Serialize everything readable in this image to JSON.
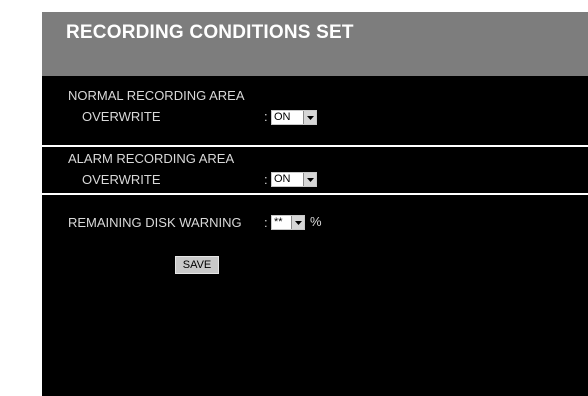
{
  "header": {
    "title": "RECORDING CONDITIONS SET"
  },
  "normal_area": {
    "heading": "NORMAL RECORDING AREA",
    "overwrite_label": "OVERWRITE",
    "separator": ":",
    "overwrite_value": "ON"
  },
  "alarm_area": {
    "heading": "ALARM RECORDING AREA",
    "overwrite_label": "OVERWRITE",
    "separator": ":",
    "overwrite_value": "ON"
  },
  "disk_warning": {
    "label": "REMAINING DISK WARNING",
    "separator": ":",
    "value": "**",
    "unit": "%"
  },
  "save_label": "SAVE",
  "colors": {
    "panel": "#000000",
    "header": "#7d7d7d",
    "text": "#d9d9d9",
    "highlight_border": "#ffffff"
  },
  "icons": {
    "dropdown": "chevron-down-icon"
  }
}
